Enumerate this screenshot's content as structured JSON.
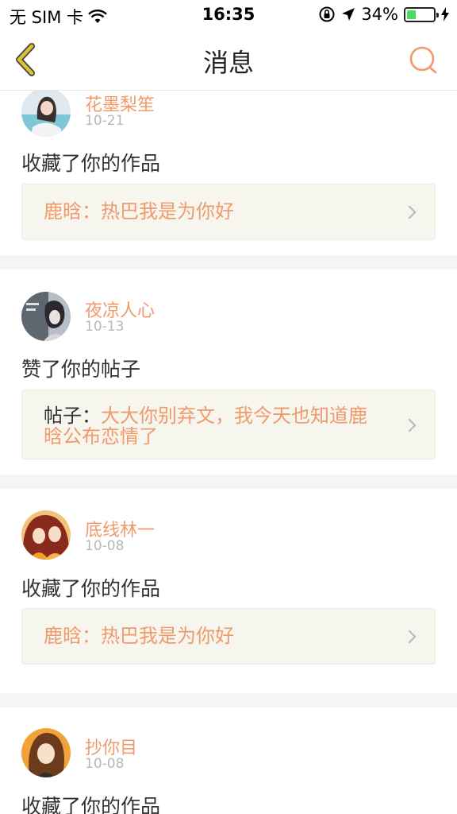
{
  "status_bar": {
    "carrier": "无 SIM 卡",
    "time": "16:35",
    "battery_percent": "34%",
    "battery_level": 0.34,
    "icons": [
      "wifi-icon",
      "orientation-lock-icon",
      "location-icon",
      "charging-icon"
    ]
  },
  "nav": {
    "title": "消息",
    "back_icon": "chevron-left-icon",
    "search_icon": "search-icon",
    "accent": "#f09a6b",
    "back_color": "#d9c236"
  },
  "messages": [
    {
      "user": "花墨梨笙",
      "date": "10-21",
      "action": "收藏了你的作品",
      "quote_prefix": "鹿晗：",
      "quote_body": "热巴我是为你好"
    },
    {
      "user": "夜凉人心",
      "date": "10-13",
      "action": "赞了你的帖子",
      "quote_prefix": "帖子：",
      "quote_body_line1": "大大你别弃文，我今天也知道鹿",
      "quote_body_line2": "晗公布恋情了"
    },
    {
      "user": "底线林一",
      "date": "10-08",
      "action": "收藏了你的作品",
      "quote_prefix": "鹿晗：",
      "quote_body": "热巴我是为你好"
    },
    {
      "user": "抄你目",
      "date": "10-08",
      "action": "收藏了你的作品"
    }
  ]
}
